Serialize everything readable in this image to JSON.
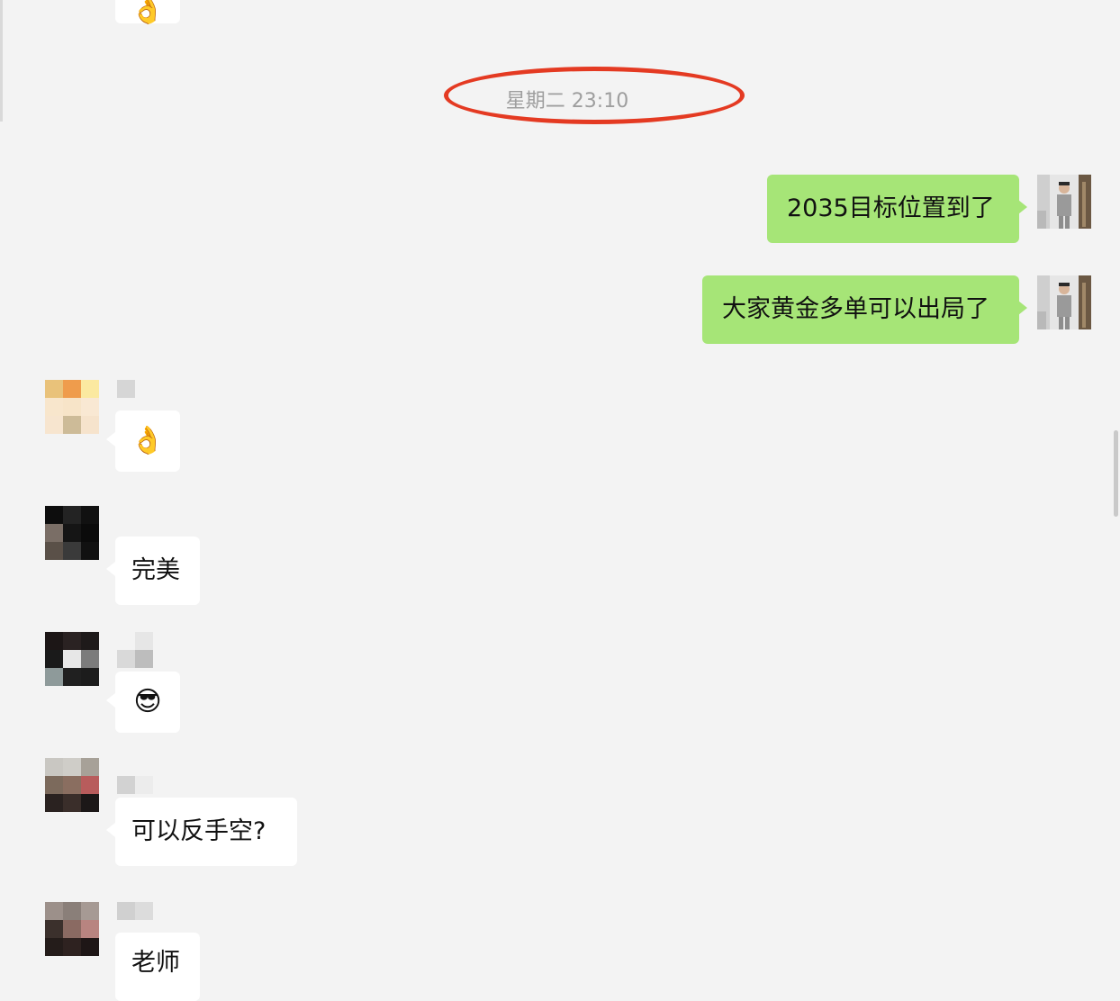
{
  "timestamp": "星期二 23:10",
  "messages": {
    "top_partial": {
      "emoji": "👌"
    },
    "out1": {
      "text": "2035目标位置到了"
    },
    "out2": {
      "text": "大家黄金多单可以出局了"
    },
    "in1": {
      "emoji": "👌"
    },
    "in2": {
      "text": "完美"
    },
    "in3": {
      "emoji": "😎"
    },
    "in4": {
      "text": "可以反手空?"
    },
    "in5_partial": {
      "text": "老师"
    }
  },
  "colors": {
    "background": "#f3f3f3",
    "incoming_bubble": "#ffffff",
    "outgoing_bubble": "#a6e577",
    "highlight_ring": "#e43a22",
    "timestamp_text": "#9e9e9e"
  },
  "icons": {
    "self_avatar": "man-in-suit-photo-avatar",
    "contact_avatars": "pixelated-avatar"
  }
}
